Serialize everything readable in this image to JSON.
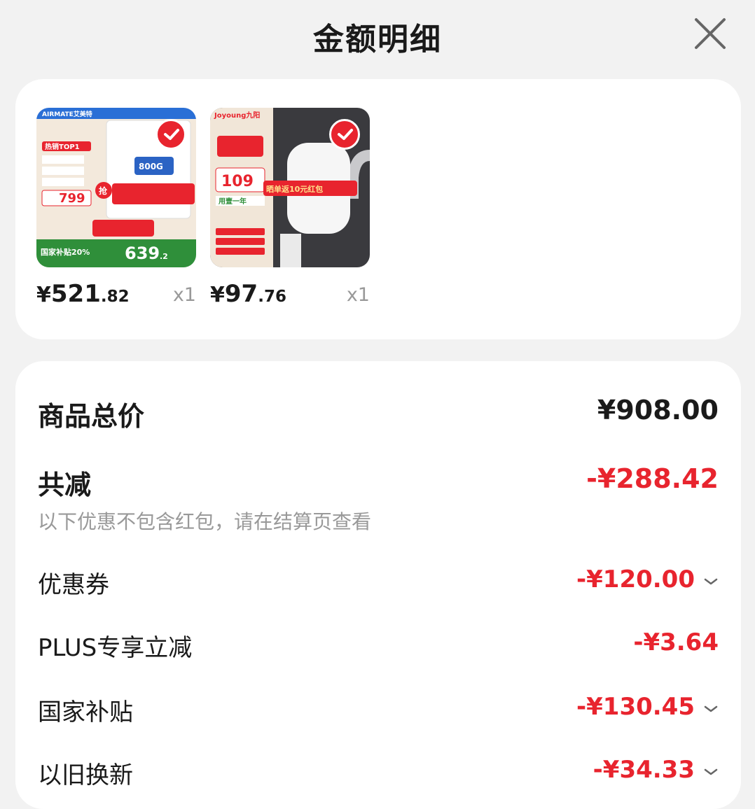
{
  "header": {
    "title": "金额明细"
  },
  "products": [
    {
      "price_symbol": "¥",
      "price_int": "521",
      "price_dec": ".82",
      "qty": "x1",
      "image_text": {
        "brand": "AIRMATE艾美特",
        "tag": "热销TOP1",
        "spec": "800G",
        "price": "799",
        "badge": "抢",
        "final": "639",
        "final_dec": ".2",
        "subsidy": "国家补贴20%"
      }
    },
    {
      "price_symbol": "¥",
      "price_int": "97",
      "price_dec": ".76",
      "qty": "x1",
      "image_text": {
        "brand": "Joyoung九阳",
        "promo": "晒单返10元红包",
        "price": "109",
        "tag": "用壹一年"
      }
    }
  ],
  "summary": {
    "total_label": "商品总价",
    "total_value": "¥908.00",
    "reduce_label": "共减",
    "reduce_value": "-¥288.42",
    "note": "以下优惠不包含红包，请在结算页查看",
    "items": [
      {
        "label": "优惠券",
        "value": "-¥120.00",
        "expandable": true
      },
      {
        "label": "PLUS专享立减",
        "value": "-¥3.64",
        "expandable": false
      },
      {
        "label": "国家补贴",
        "value": "-¥130.45",
        "expandable": true
      },
      {
        "label": "以旧换新",
        "value": "-¥34.33",
        "expandable": true
      }
    ]
  },
  "colors": {
    "accent": "#e8242e",
    "muted": "#999999",
    "background": "#f2f2f2"
  },
  "icons": {
    "close": "close-icon",
    "check": "check-icon",
    "expand": "chevron-down-icon"
  }
}
